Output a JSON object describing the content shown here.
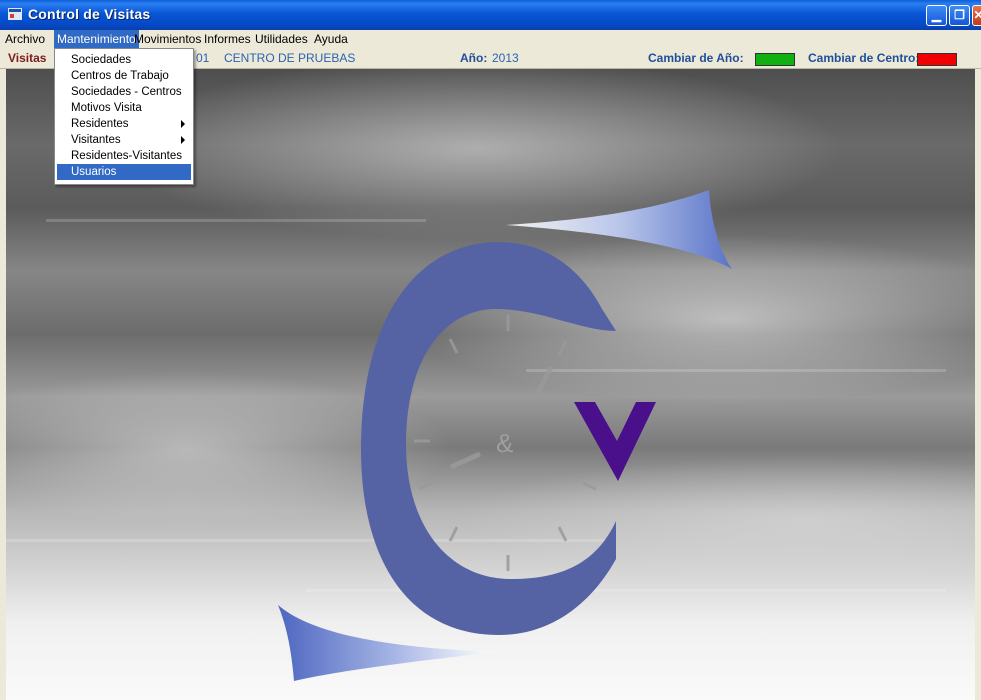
{
  "window": {
    "title": "Control de Visitas",
    "buttons": {
      "minimize": "_",
      "maximize": "▫",
      "close": "X"
    }
  },
  "menubar": {
    "items": [
      {
        "label": "Archivo"
      },
      {
        "label": "Mantenimiento"
      },
      {
        "label": "Movimientos"
      },
      {
        "label": "Informes"
      },
      {
        "label": "Utilidades"
      },
      {
        "label": "Ayuda"
      }
    ]
  },
  "infobar": {
    "section": "Visitas",
    "center_code": "01",
    "center_name": "CENTRO DE PRUEBAS",
    "year_label": "Año:",
    "year_value": "2013",
    "change_year_label": "Cambiar de Año:",
    "change_center_label": "Cambiar de Centro:",
    "colors": {
      "year_swatch": "#10b010",
      "center_swatch": "#f00000"
    }
  },
  "dropdown": {
    "items": [
      {
        "label": "Sociedades",
        "submenu": false
      },
      {
        "label": "Centros de Trabajo",
        "submenu": false
      },
      {
        "label": "Sociedades - Centros",
        "submenu": false
      },
      {
        "label": "Motivos Visita",
        "submenu": false
      },
      {
        "label": "Residentes",
        "submenu": true
      },
      {
        "label": "Visitantes",
        "submenu": true
      },
      {
        "label": "Residentes-Visitantes",
        "submenu": false
      },
      {
        "label": "Usuarios",
        "submenu": false,
        "selected": true
      }
    ]
  },
  "logo": {
    "ampersand": "&",
    "letter_v": "V",
    "colors": {
      "c_blue": "#5563a5",
      "v_purple": "#4a0f8a"
    }
  }
}
